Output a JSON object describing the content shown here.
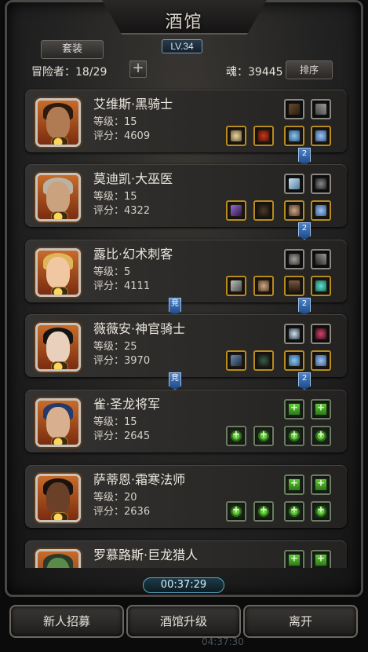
{
  "header": {
    "title": "酒馆",
    "level_badge": "LV.34",
    "suit_tab": "套装",
    "adventurers": "冒险者：18/29",
    "add_symbol": "+",
    "soul": "魂：39445",
    "sort_label": "排序"
  },
  "level_prefix": "等级：",
  "score_prefix": "评分：",
  "heroes": [
    {
      "name": "艾维斯·黑骑士",
      "level": "15",
      "score": "4609"
    },
    {
      "name": "莫迪凯·大巫医",
      "level": "15",
      "score": "4322"
    },
    {
      "name": "露比·幻术刺客",
      "level": "5",
      "score": "4111"
    },
    {
      "name": "薇薇安·神官骑士",
      "level": "25",
      "score": "3970"
    },
    {
      "name": "雀·圣龙将军",
      "level": "15",
      "score": "2645"
    },
    {
      "name": "萨蒂恩·霜寒法师",
      "level": "20",
      "score": "2636"
    },
    {
      "name": "罗慕路斯·巨龙猎人",
      "level": "",
      "score": ""
    }
  ],
  "set_tags": [
    "2",
    "2",
    "2",
    "2"
  ],
  "arena_tags": [
    "竞",
    "竞"
  ],
  "footer": {
    "timer": "00:37:29",
    "faint_time": "04:37:30",
    "recruit_button": "新人招募",
    "upgrade_button": "酒馆升级",
    "leave_button": "离开"
  },
  "colors": {
    "portrait_frame": "#c8c4bd",
    "slot_gold": "#b88c1e",
    "empty_slot_green": "#5ecb36",
    "set_tag_blue": "#4f83c5"
  }
}
